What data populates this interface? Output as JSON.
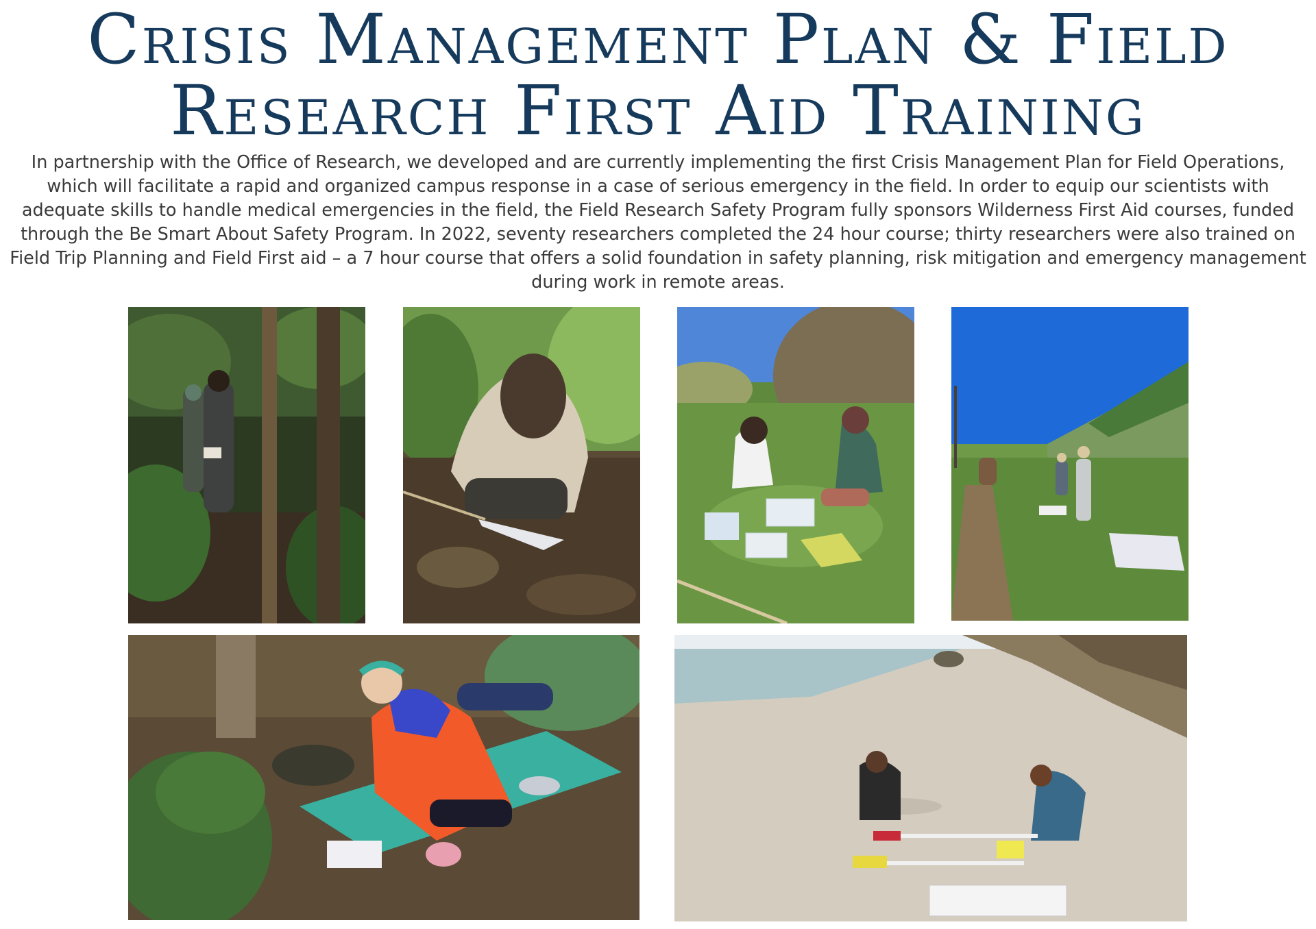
{
  "page": {
    "title": "Crisis Management Plan & Field Research First Aid Training",
    "body": "In partnership with the Office of Research, we developed and are currently implementing the first Crisis Management Plan for Field Operations, which will facilitate a rapid and organized campus response in a case of serious emergency in the field. In order to equip our scientists with adequate skills to handle medical emergencies in the field, the Field Research Safety Program fully sponsors Wilderness First Aid courses, funded through the Be Smart About Safety Program. In 2022, seventy researchers completed the 24 hour course; thirty researchers were also trained on Field Trip Planning and Field First aid – a 7 hour course that offers a solid foundation in safety planning, risk mitigation and emergency management during work in remote areas."
  },
  "colors": {
    "title": "#163a5c",
    "body_text": "#3a3a3a",
    "background": "#ffffff"
  }
}
